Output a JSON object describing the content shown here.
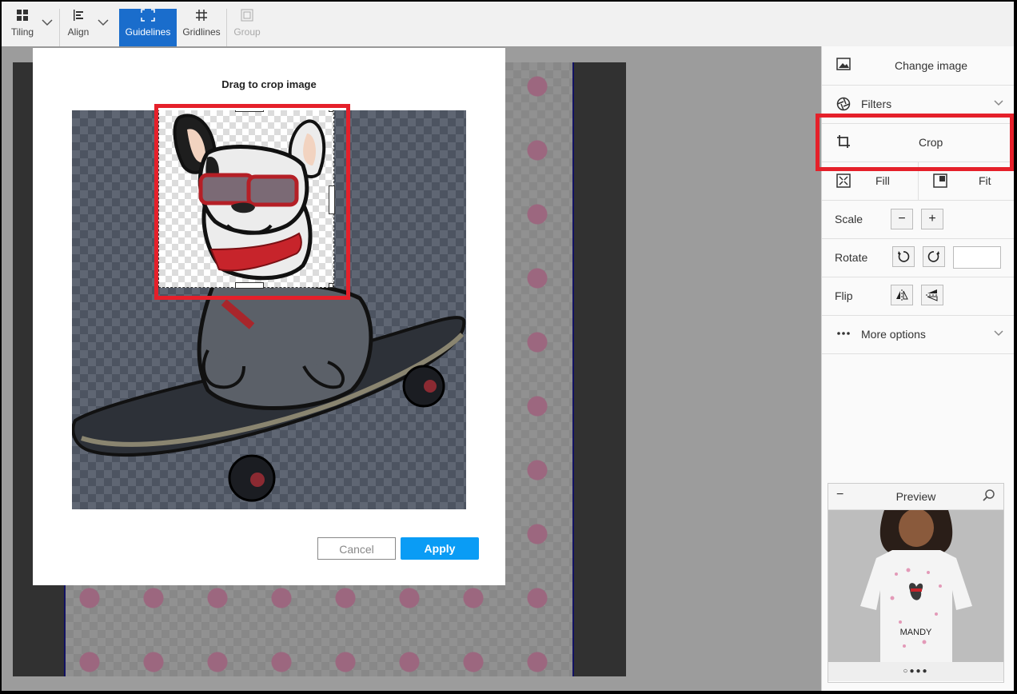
{
  "toolbar": {
    "tiling_label": "Tiling",
    "align_label": "Align",
    "guidelines_label": "Guidelines",
    "gridlines_label": "Gridlines",
    "group_label": "Group"
  },
  "crop_dialog": {
    "title": "Drag to crop image",
    "cancel_label": "Cancel",
    "apply_label": "Apply"
  },
  "panel": {
    "change_image_label": "Change image",
    "filters_label": "Filters",
    "crop_label": "Crop",
    "fill_label": "Fill",
    "fit_label": "Fit",
    "scale_label": "Scale",
    "scale_minus": "−",
    "scale_plus": "+",
    "rotate_label": "Rotate",
    "rotate_value": "",
    "flip_label": "Flip",
    "more_options_label": "More options"
  },
  "preview": {
    "title": "Preview",
    "shirt_text": "MANDY",
    "dots": "○●●●"
  },
  "colors": {
    "accent": "#1a6dcc",
    "apply": "#0a9cf5",
    "highlight": "#e5202a"
  }
}
